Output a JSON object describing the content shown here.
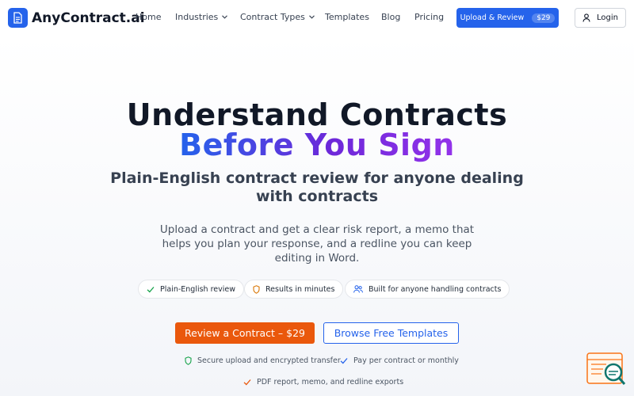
{
  "nav": {
    "brand": "AnyContract.ai",
    "links": {
      "home": "Home",
      "industries": "Industries",
      "contract_types": "Contract Types",
      "templates": "Templates",
      "blog": "Blog",
      "pricing": "Pricing"
    },
    "upload_button": "Upload & Review",
    "upload_price": "$29",
    "login": "Login"
  },
  "hero": {
    "title_line1": "Understand Contracts",
    "title_line2": "Before You Sign",
    "subtitle": "Plain-English contract review for anyone dealing with contracts",
    "description": "Upload a contract and get a clear risk report, a memo that helps you plan your response, and a redline you can keep editing in Word.",
    "chips": [
      {
        "label": "Plain-English review",
        "icon": "check-icon"
      },
      {
        "label": "Results in minutes",
        "icon": "shield-icon"
      },
      {
        "label": "Built for anyone handling contracts",
        "icon": "users-icon"
      }
    ],
    "cta_primary": "Review a Contract – $29",
    "cta_secondary": "Browse Free Templates",
    "trust": [
      {
        "label": "Secure upload and encrypted transfer",
        "icon": "shield-icon"
      },
      {
        "label": "Pay per contract or monthly",
        "icon": "check-icon"
      },
      {
        "label": "PDF report, memo, and redline exports",
        "icon": "check-icon"
      }
    ]
  },
  "colors": {
    "brand_blue": "#2563eb",
    "cta_orange": "#ea580c",
    "gradient_end": "#9333ea",
    "check_green": "#16a34a",
    "shield_amber": "#d97706"
  }
}
